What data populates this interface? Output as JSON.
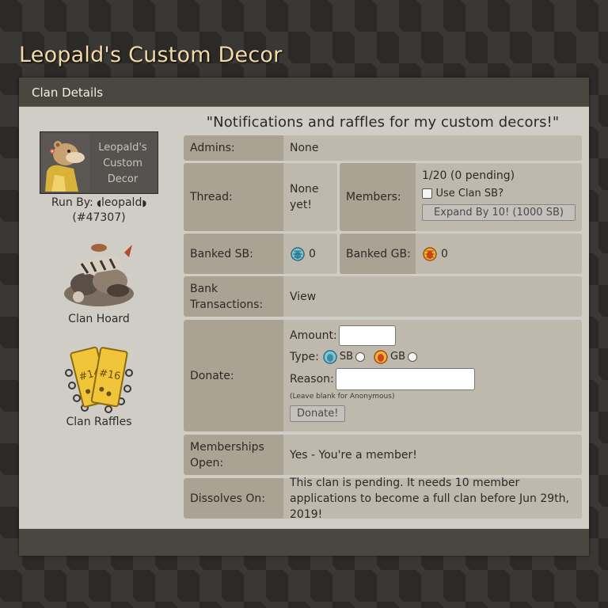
{
  "site": {
    "title": "Leopald's Custom Decor"
  },
  "panel": {
    "header": "Clan Details"
  },
  "sidebar": {
    "logo_text": "Leopald's Custom Decor",
    "run_by_label": "Run By:",
    "owner_name": "leopald",
    "owner_id": "(#47307)",
    "hoard_label": "Clan Hoard",
    "raffles_label": "Clan Raffles"
  },
  "motto": "\"Notifications and raffles for my custom decors!\"",
  "details": {
    "admins_label": "Admins:",
    "admins_value": "None",
    "thread_label": "Thread:",
    "thread_value": "None yet!",
    "members_label": "Members:",
    "members_value": "1/20 (0 pending)",
    "use_clan_sb_label": "Use Clan SB?",
    "expand_button": "Expand By 10! (1000 SB)",
    "banked_sb_label": "Banked SB:",
    "banked_sb_value": "0",
    "banked_gb_label": "Banked GB:",
    "banked_gb_value": "0",
    "bank_tx_label": "Bank Transactions:",
    "bank_tx_link": "View",
    "donate_label": "Donate:",
    "amount_label": "Amount:",
    "type_label": "Type:",
    "sb_option": "SB",
    "gb_option": "GB",
    "reason_label": "Reason:",
    "reason_hint": "(Leave blank for Anonymous)",
    "donate_button": "Donate!",
    "memberships_label": "Memberships Open:",
    "memberships_value": "Yes - You're a member!",
    "dissolves_label": "Dissolves On:",
    "dissolves_value": "This clan is pending. It needs 10 member applications to become a full clan before Jun 29th, 2019!"
  },
  "icons": {
    "site_bg": "diamond-pattern",
    "sb_coin": "blue-scarab-coin-icon",
    "gb_coin": "gold-scarab-coin-icon",
    "logo": "leopard-mascot-icon",
    "hoard": "hoard-pile-icon",
    "raffles": "raffle-tickets-icon"
  },
  "colors": {
    "title": "#f3d9a4",
    "header_bg": "#4a4640",
    "panel_bg": "#cfcdc6",
    "label_bg": "#aaa393",
    "value_bg": "#bfb9ad"
  }
}
